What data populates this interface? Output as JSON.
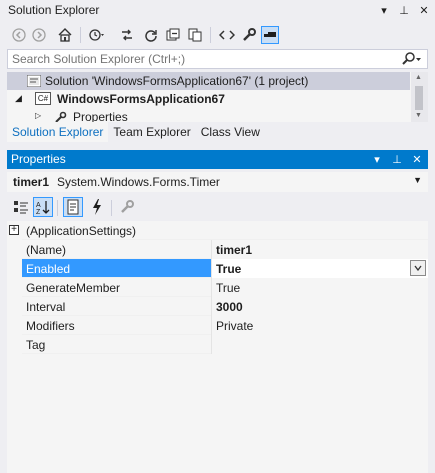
{
  "solution_explorer": {
    "title": "Solution Explorer",
    "title_buttons": [
      "▾",
      "⊥",
      "✕"
    ],
    "search": {
      "placeholder": "Search Solution Explorer (Ctrl+;)",
      "value": ""
    },
    "tree": [
      {
        "label": "Solution 'WindowsFormsApplication67' (1 project)",
        "selected": true
      },
      {
        "label": "WindowsFormsApplication67",
        "bold": true
      },
      {
        "label": "Properties"
      }
    ],
    "tabs": [
      "Solution Explorer",
      "Team Explorer",
      "Class View"
    ],
    "active_tab": 0
  },
  "properties": {
    "title": "Properties",
    "title_buttons": [
      "▾",
      "⊥",
      "✕"
    ],
    "object": {
      "name": "timer1",
      "type": "System.Windows.Forms.Timer"
    },
    "category": {
      "label": "(ApplicationSettings)",
      "expander": "+"
    },
    "rows": [
      {
        "name": "(Name)",
        "value": "timer1",
        "bold": true
      },
      {
        "name": "Enabled",
        "value": "True",
        "bold": true,
        "selected": true
      },
      {
        "name": "GenerateMember",
        "value": "True",
        "bold": false
      },
      {
        "name": "Interval",
        "value": "3000",
        "bold": true
      },
      {
        "name": "Modifiers",
        "value": "Private",
        "bold": false
      },
      {
        "name": "Tag",
        "value": "",
        "bold": false
      }
    ]
  },
  "colors": {
    "accent": "#007acc",
    "selection": "#3399ff",
    "background": "#eeeef2",
    "active_tab_text": "#0e70c0"
  }
}
